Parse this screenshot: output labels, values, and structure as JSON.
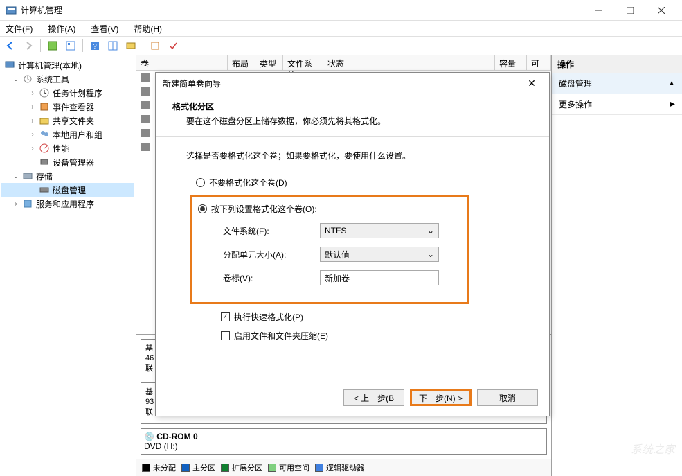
{
  "window": {
    "title": "计算机管理"
  },
  "menus": {
    "file": "文件(F)",
    "action": "操作(A)",
    "view": "查看(V)",
    "help": "帮助(H)"
  },
  "tree": {
    "root": "计算机管理(本地)",
    "systemTools": "系统工具",
    "taskScheduler": "任务计划程序",
    "eventViewer": "事件查看器",
    "sharedFolders": "共享文件夹",
    "localUsers": "本地用户和组",
    "performance": "性能",
    "deviceManager": "设备管理器",
    "storage": "存储",
    "diskMgmt": "磁盘管理",
    "servicesApps": "服务和应用程序"
  },
  "list": {
    "cols": {
      "volume": "卷",
      "layout": "布局",
      "type": "类型",
      "fs": "文件系统",
      "status": "状态",
      "capacity": "容量",
      "free": "可"
    }
  },
  "disk": {
    "basic": "基",
    "size1": "46",
    "online1": "联",
    "size2": "93",
    "cdrom": "CD-ROM 0",
    "dvd": "DVD (H:)"
  },
  "legend": {
    "unalloc": "未分配",
    "primary": "主分区",
    "extended": "扩展分区",
    "free": "可用空间",
    "logical": "逻辑驱动器"
  },
  "actions": {
    "header": "操作",
    "diskMgmt": "磁盘管理",
    "more": "更多操作"
  },
  "dialog": {
    "title": "新建简单卷向导",
    "heading": "格式化分区",
    "subheading": "要在这个磁盘分区上储存数据，你必须先将其格式化。",
    "prompt": "选择是否要格式化这个卷；如果要格式化，要使用什么设置。",
    "radio_no": "不要格式化这个卷(D)",
    "radio_yes": "按下列设置格式化这个卷(O):",
    "fs_label": "文件系统(F):",
    "fs_value": "NTFS",
    "alloc_label": "分配单元大小(A):",
    "alloc_value": "默认值",
    "vol_label": "卷标(V):",
    "vol_value": "新加卷",
    "quick_format": "执行快速格式化(P)",
    "compress": "启用文件和文件夹压缩(E)",
    "back": "< 上一步(B",
    "next": "下一步(N) >",
    "cancel": "取消"
  },
  "watermark": "系统之家"
}
